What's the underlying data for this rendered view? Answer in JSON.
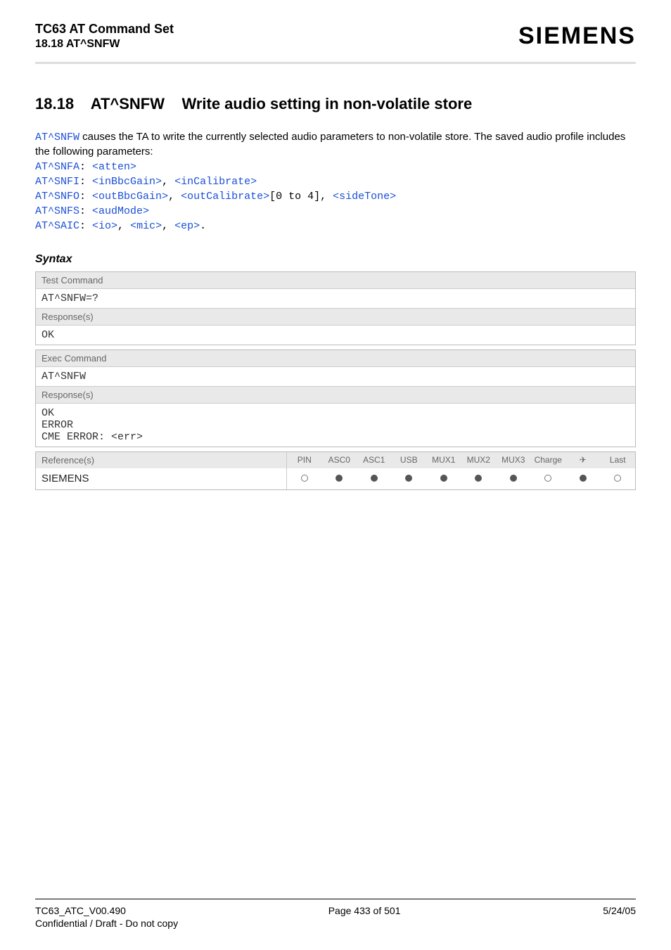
{
  "header": {
    "doc_title": "TC63 AT Command Set",
    "doc_section": "18.18 AT^SNFW",
    "brand": "SIEMENS"
  },
  "section": {
    "number": "18.18",
    "cmd": "AT^SNFW",
    "title": "Write audio setting in non-volatile store"
  },
  "intro": {
    "cmd": "AT^SNFW",
    "text_after": " causes the TA to write the currently selected audio parameters to non-volatile store. The saved audio profile includes the following parameters:"
  },
  "profile": {
    "lines": [
      {
        "cmd": "AT^SNFA",
        "sep": ": ",
        "params": [
          "<atten>"
        ],
        "tail": ""
      },
      {
        "cmd": "AT^SNFI",
        "sep": ": ",
        "params": [
          "<inBbcGain>",
          "<inCalibrate>"
        ],
        "joiner": ", ",
        "tail": ""
      },
      {
        "cmd": "AT^SNFO",
        "sep": ": ",
        "params": [
          "<outBbcGain>",
          "<outCalibrate>"
        ],
        "joiner": ", ",
        "mid": "[0 to 4], ",
        "params2": [
          "<sideTone>"
        ],
        "tail": ""
      },
      {
        "cmd": "AT^SNFS",
        "sep": ": ",
        "params": [
          "<audMode>"
        ],
        "tail": ""
      },
      {
        "cmd": "AT^SAIC",
        "sep": ": ",
        "params": [
          "<io>",
          "<mic>",
          "<ep>"
        ],
        "joiner": ", ",
        "tail": "."
      }
    ]
  },
  "syntax": {
    "title": "Syntax",
    "blocks": [
      {
        "label1": "Test Command",
        "content1": "AT^SNFW=?",
        "label2": "Response(s)",
        "content2": "OK"
      },
      {
        "label1": "Exec Command",
        "content1": "AT^SNFW",
        "label2": "Response(s)",
        "content2": "OK\nERROR\nCME ERROR: <err>"
      }
    ],
    "reference": {
      "label": "Reference(s)",
      "value": "SIEMENS",
      "cols": [
        "PIN",
        "ASC0",
        "ASC1",
        "USB",
        "MUX1",
        "MUX2",
        "MUX3",
        "Charge",
        "✈",
        "Last"
      ],
      "states": [
        "empty",
        "filled",
        "filled",
        "filled",
        "filled",
        "filled",
        "filled",
        "empty",
        "filled",
        "empty"
      ]
    }
  },
  "footer": {
    "left": "TC63_ATC_V00.490",
    "center": "Page 433 of 501",
    "right": "5/24/05",
    "conf": "Confidential / Draft - Do not copy"
  }
}
